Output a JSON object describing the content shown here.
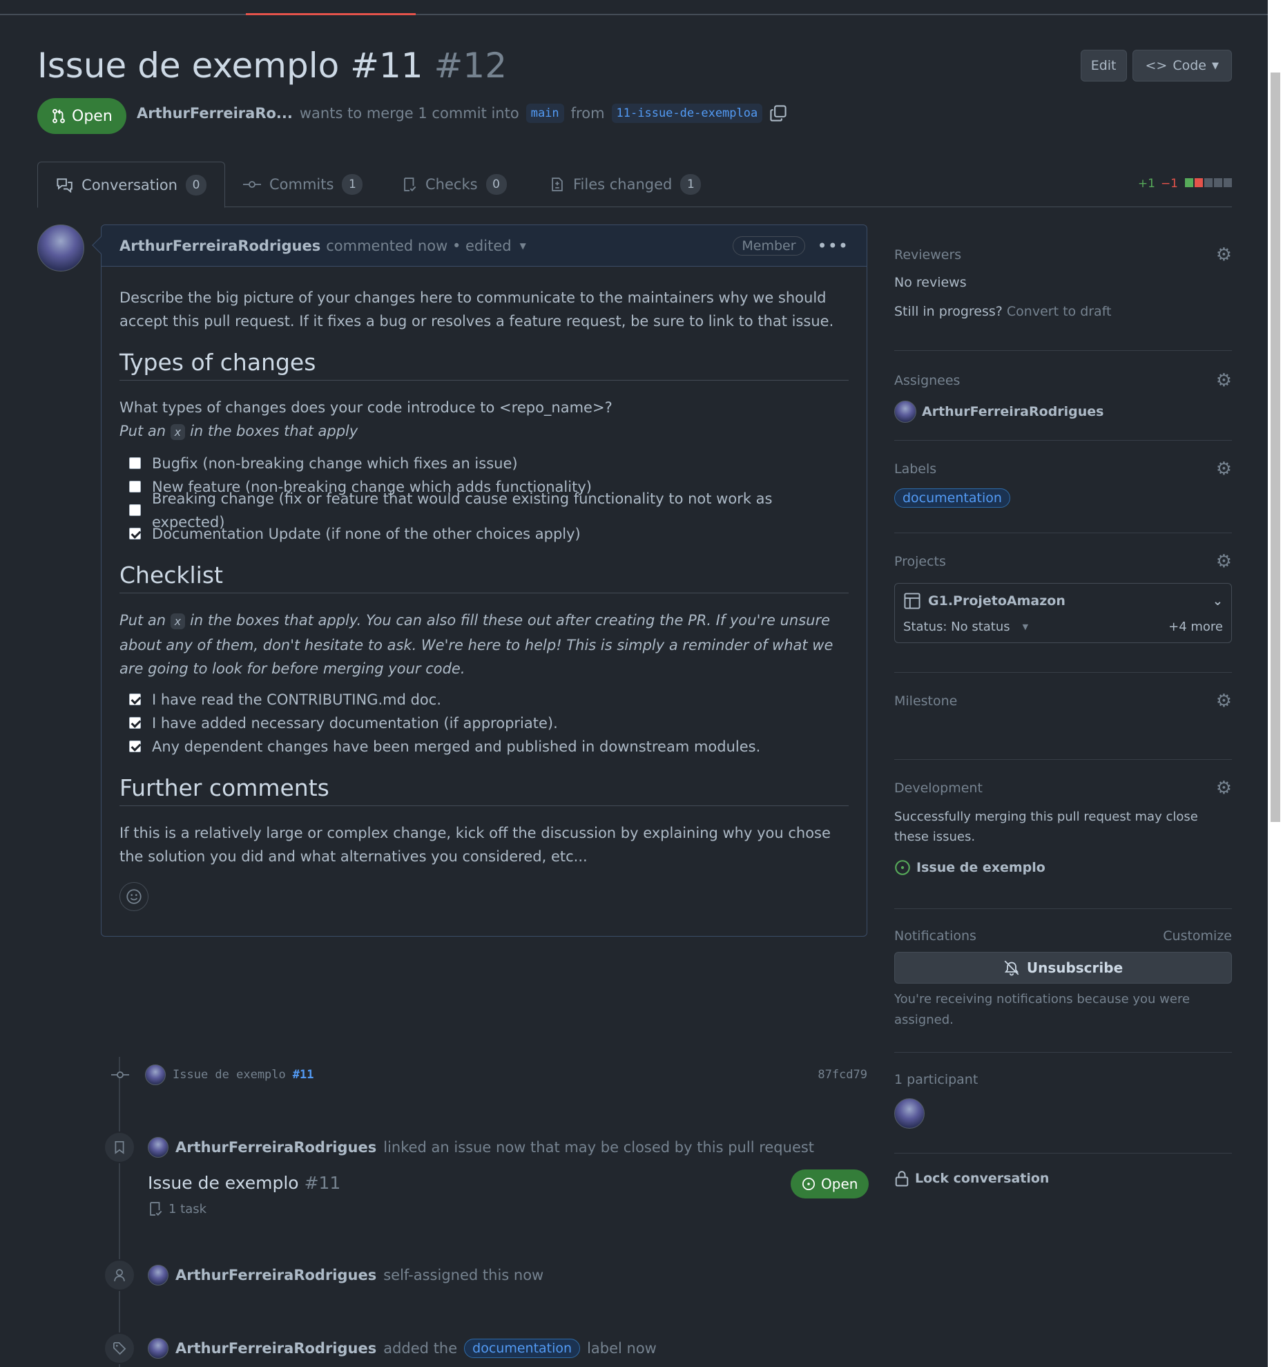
{
  "pr": {
    "title": "Issue de exemplo #11",
    "number": "#12",
    "state": "Open",
    "author": "ArthurFerreiraRo...",
    "merge_text": "wants to merge 1 commit into",
    "base_branch": "main",
    "from_text": "from",
    "head_branch": "11-issue-de-exemploa"
  },
  "header_buttons": {
    "edit": "Edit",
    "code": "Code"
  },
  "tabs": [
    {
      "label": "Conversation",
      "count": "0"
    },
    {
      "label": "Commits",
      "count": "1"
    },
    {
      "label": "Checks",
      "count": "0"
    },
    {
      "label": "Files changed",
      "count": "1"
    }
  ],
  "diffstat": {
    "additions": "+1",
    "deletions": "−1"
  },
  "comment": {
    "author": "ArthurFerreiraRodrigues",
    "meta": "commented now • edited",
    "role": "Member",
    "intro": "Describe the big picture of your changes here to communicate to the maintainers why we should accept this pull request. If it fixes a bug or resolves a feature request, be sure to link to that issue.",
    "h_types": "Types of changes",
    "types_q": "What types of changes does your code introduce to <repo_name>?",
    "put_an": "Put an",
    "x": "x",
    "in_boxes": "in the boxes that apply",
    "types": [
      {
        "label": "Bugfix (non-breaking change which fixes an issue)",
        "checked": false
      },
      {
        "label": "New feature (non-breaking change which adds functionality)",
        "checked": false
      },
      {
        "label": "Breaking change (fix or feature that would cause existing functionality to not work as expected)",
        "checked": false
      },
      {
        "label": "Documentation Update (if none of the other choices apply)",
        "checked": true
      }
    ],
    "h_checklist": "Checklist",
    "checklist_note": "in the boxes that apply. You can also fill these out after creating the PR. If you're unsure about any of them, don't hesitate to ask. We're here to help! This is simply a reminder of what we are going to look for before merging your code.",
    "checklist": [
      {
        "label": "I have read the CONTRIBUTING.md doc.",
        "checked": true
      },
      {
        "label": "I have added necessary documentation (if appropriate).",
        "checked": true
      },
      {
        "label": "Any dependent changes have been merged and published in downstream modules.",
        "checked": true
      }
    ],
    "h_further": "Further comments",
    "further": "If this is a relatively large or complex change, kick off the discussion by explaining why you chose the solution you did and what alternatives you considered, etc..."
  },
  "timeline": {
    "commit": {
      "message": "Issue de exemplo",
      "ref": "#11",
      "sha": "87fcd79"
    },
    "linked": {
      "author": "ArthurFerreiraRodrigues",
      "text": "linked an issue now that may be closed by this pull request",
      "issue_title": "Issue de exemplo",
      "issue_num": "#11",
      "tasks": "1 task",
      "state": "Open"
    },
    "assigned": {
      "author": "ArthurFerreiraRodrigues",
      "text": "self-assigned this now"
    },
    "labeled": {
      "author": "ArthurFerreiraRodrigues",
      "pre": "added the",
      "label": "documentation",
      "post": "label now"
    }
  },
  "sidebar": {
    "reviewers": {
      "title": "Reviewers",
      "value": "No reviews",
      "progress": "Still in progress?",
      "draft": "Convert to draft"
    },
    "assignees": {
      "title": "Assignees",
      "name": "ArthurFerreiraRodrigues"
    },
    "labels": {
      "title": "Labels",
      "label": "documentation"
    },
    "projects": {
      "title": "Projects",
      "name": "G1.ProjetoAmazon",
      "status": "Status: No status",
      "more": "+4 more"
    },
    "milestone": {
      "title": "Milestone"
    },
    "development": {
      "title": "Development",
      "desc": "Successfully merging this pull request may close these issues.",
      "issue": "Issue de exemplo"
    },
    "notifications": {
      "title": "Notifications",
      "customize": "Customize",
      "button": "Unsubscribe",
      "reason": "You're receiving notifications because you were assigned."
    },
    "participants": {
      "title": "1 participant"
    },
    "lock": "Lock conversation"
  },
  "colors": {
    "bg": "#22272e",
    "open_green": "#347d39",
    "link_blue": "#539bf5",
    "accent_orange": "#e5534b"
  }
}
